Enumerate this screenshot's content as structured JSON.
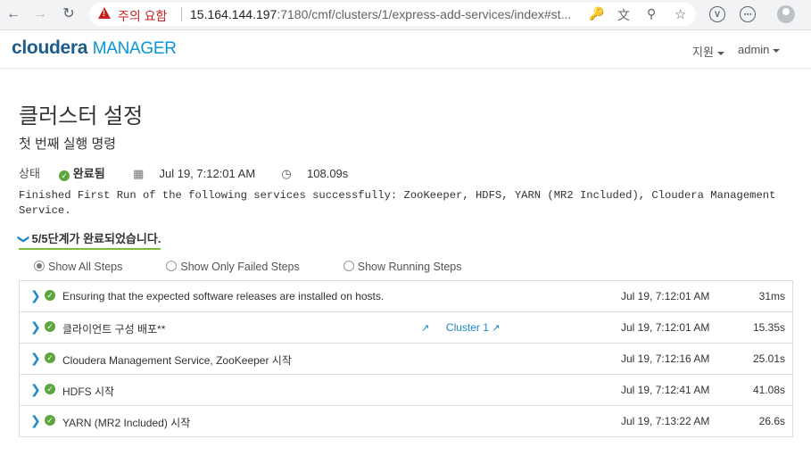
{
  "browser": {
    "warning_label": "주의 요함",
    "url_host": "15.164.144.197",
    "url_rest": ":7180/cmf/clusters/1/express-add-services/index#st..."
  },
  "header": {
    "brand": "cloudera",
    "product": "MANAGER",
    "support_label": "지원",
    "user_label": "admin"
  },
  "page": {
    "title": "클러스터 설정",
    "subtitle": "첫 번째 실행 명령"
  },
  "status": {
    "label": "상태",
    "value": "완료됨",
    "date": "Jul 19, 7:12:01 AM",
    "duration": "108.09s"
  },
  "message": "Finished First Run of the following services successfully: ZooKeeper, HDFS, YARN (MR2 Included), Cloudera Management Service.",
  "progress_summary": "5/5단계가 완료되었습니다.",
  "filters": [
    {
      "label": "Show All Steps",
      "selected": true
    },
    {
      "label": "Show Only Failed Steps",
      "selected": false
    },
    {
      "label": "Show Running Steps",
      "selected": false
    }
  ],
  "steps": [
    {
      "name": "Ensuring that the expected software releases are installed on hosts.",
      "link": "",
      "time": "Jul 19, 7:12:01 AM",
      "duration": "31ms"
    },
    {
      "name": "클라이언트 구성 배포**",
      "link": "Cluster 1",
      "time": "Jul 19, 7:12:01 AM",
      "duration": "15.35s"
    },
    {
      "name": "Cloudera Management Service, ZooKeeper 시작",
      "link": "",
      "time": "Jul 19, 7:12:16 AM",
      "duration": "25.01s"
    },
    {
      "name": "HDFS 시작",
      "link": "",
      "time": "Jul 19, 7:12:41 AM",
      "duration": "41.08s"
    },
    {
      "name": "YARN (MR2 Included) 시작",
      "link": "",
      "time": "Jul 19, 7:13:22 AM",
      "duration": "26.6s"
    }
  ],
  "colors": {
    "accent": "#1e88c8",
    "success": "#5ba63d",
    "brand": "#1c5c8c",
    "warning": "#c5221f"
  }
}
